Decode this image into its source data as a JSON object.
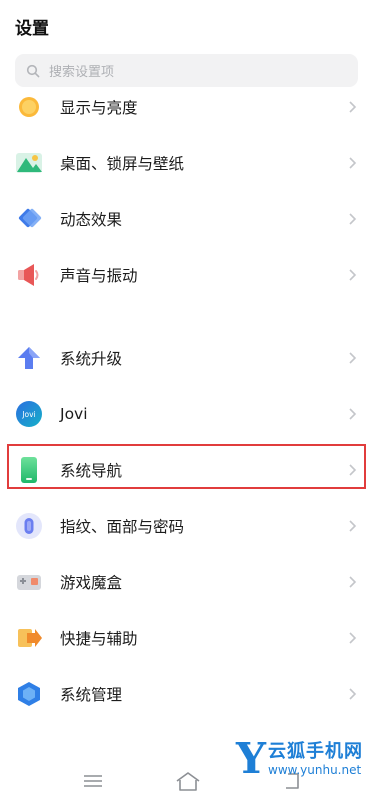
{
  "header": {
    "title": "设置"
  },
  "search": {
    "placeholder": "搜索设置项"
  },
  "items": [
    {
      "label": "显示与亮度",
      "icon": "brightness-icon"
    },
    {
      "label": "桌面、锁屏与壁纸",
      "icon": "wallpaper-icon"
    },
    {
      "label": "动态效果",
      "icon": "animation-icon"
    },
    {
      "label": "声音与振动",
      "icon": "speaker-icon"
    },
    {
      "label": "系统升级",
      "icon": "upgrade-arrow-icon"
    },
    {
      "label": "Jovi",
      "icon": "jovi-icon",
      "icon_text": "Jovi"
    },
    {
      "label": "系统导航",
      "icon": "phone-navigation-icon"
    },
    {
      "label": "指纹、面部与密码",
      "icon": "fingerprint-icon"
    },
    {
      "label": "游戏魔盒",
      "icon": "game-box-icon"
    },
    {
      "label": "快捷与辅助",
      "icon": "shortcut-icon"
    },
    {
      "label": "系统管理",
      "icon": "system-management-icon"
    }
  ],
  "watermark": {
    "letter": "Y",
    "name": "云狐手机网",
    "url": "www.yunhu.net"
  },
  "colors": {
    "highlight": "#e13c3c",
    "watermark": "#1e7fd6"
  }
}
